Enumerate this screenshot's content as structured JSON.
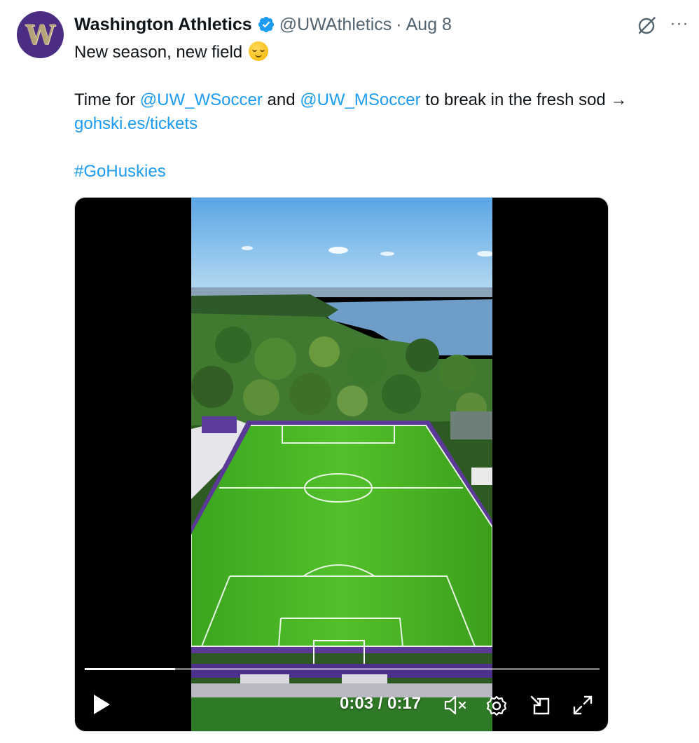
{
  "tweet": {
    "avatar_letter": "W",
    "author_name": "Washington Athletics",
    "handle": "@UWAthletics",
    "separator": "·",
    "date": "Aug 8",
    "more_label": "···",
    "line1": "New season, new field",
    "line2_prefix": "Time for ",
    "mention1": "@UW_WSoccer",
    "line2_mid": " and ",
    "mention2": "@UW_MSoccer",
    "line2_suffix": " to break in the fresh sod →",
    "link": "gohski.es/tickets",
    "hashtag": "#GoHuskies"
  },
  "video": {
    "current_time": "0:03",
    "duration": "0:17",
    "time_display": "0:03 / 0:17",
    "progress_fraction": 0.176
  },
  "icons": {
    "verified": "verified-badge-icon",
    "grok": "grok-icon",
    "more": "more-icon",
    "play": "play-icon",
    "mute": "mute-icon",
    "settings": "gear-icon",
    "dock": "dock-icon",
    "fullscreen": "fullscreen-icon"
  },
  "colors": {
    "link": "#1d9bf0",
    "verified": "#1d9bf0",
    "avatar_bg": "#4b2e83",
    "avatar_letter": "#b7a57a",
    "muted_text": "#536471"
  }
}
